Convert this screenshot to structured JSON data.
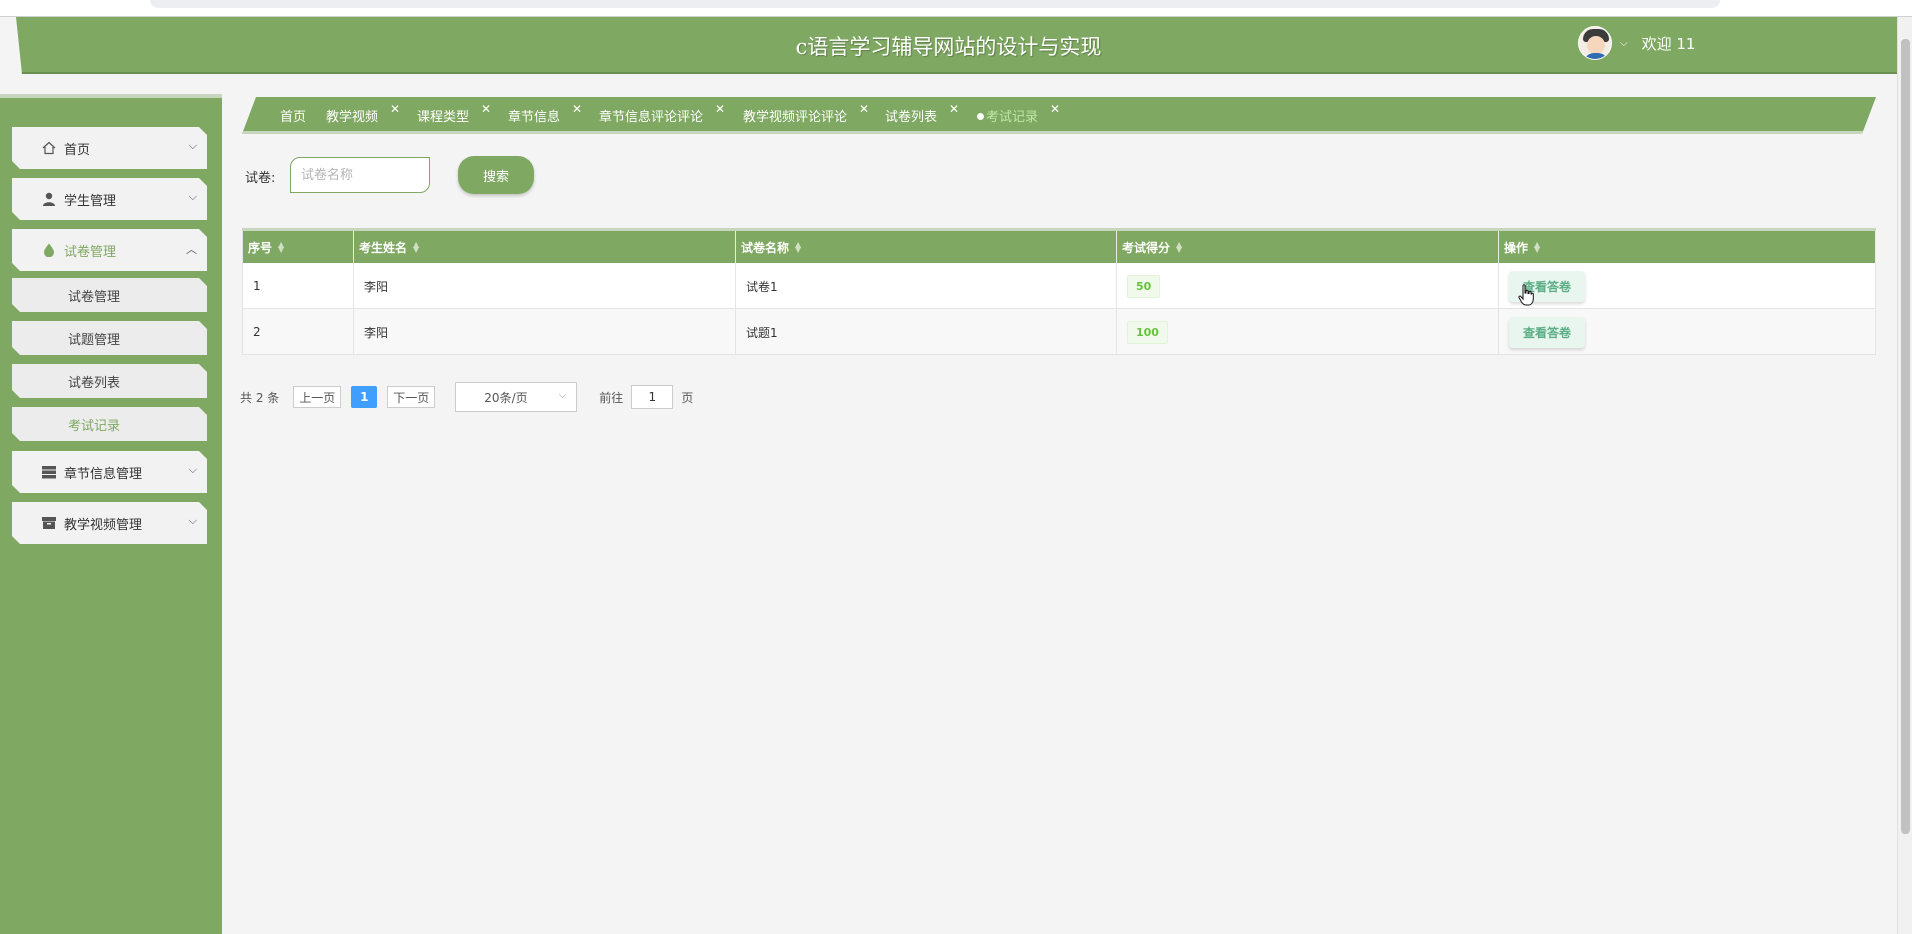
{
  "header": {
    "title": "c语言学习辅导网站的设计与实现",
    "welcome": "欢迎 11"
  },
  "sidebar": {
    "items": [
      {
        "label": "首页",
        "icon": "home-icon"
      },
      {
        "label": "学生管理",
        "icon": "user-icon"
      },
      {
        "label": "试卷管理",
        "icon": "drop-icon",
        "expanded": true
      },
      {
        "label": "章节信息管理",
        "icon": "list-icon"
      },
      {
        "label": "教学视频管理",
        "icon": "archive-icon"
      }
    ],
    "subitems": [
      {
        "label": "试卷管理"
      },
      {
        "label": "试题管理"
      },
      {
        "label": "试卷列表"
      },
      {
        "label": "考试记录",
        "current": true
      }
    ]
  },
  "tabs": [
    {
      "label": "首页"
    },
    {
      "label": "教学视频"
    },
    {
      "label": "课程类型"
    },
    {
      "label": "章节信息"
    },
    {
      "label": "章节信息评论评论"
    },
    {
      "label": "教学视频评论评论"
    },
    {
      "label": "试卷列表"
    },
    {
      "label": "考试记录",
      "active": true
    }
  ],
  "search": {
    "label": "试卷:",
    "placeholder": "试卷名称",
    "button": "搜索"
  },
  "table": {
    "headers": [
      "序号",
      "考生姓名",
      "试卷名称",
      "考试得分",
      "操作"
    ],
    "rows": [
      {
        "index": "1",
        "name": "李阳",
        "paper": "试卷1",
        "score": "50",
        "action": "查看答卷"
      },
      {
        "index": "2",
        "name": "李阳",
        "paper": "试题1",
        "score": "100",
        "action": "查看答卷"
      }
    ]
  },
  "pagination": {
    "total": "共 2 条",
    "prev": "上一页",
    "current": "1",
    "next": "下一页",
    "page_size": "20条/页",
    "goto_label": "前往",
    "goto_value": "1",
    "page_suffix": "页"
  },
  "colors": {
    "accent": "#7fa862",
    "page_button": "#409eff",
    "score_tag": "#67c23a"
  }
}
